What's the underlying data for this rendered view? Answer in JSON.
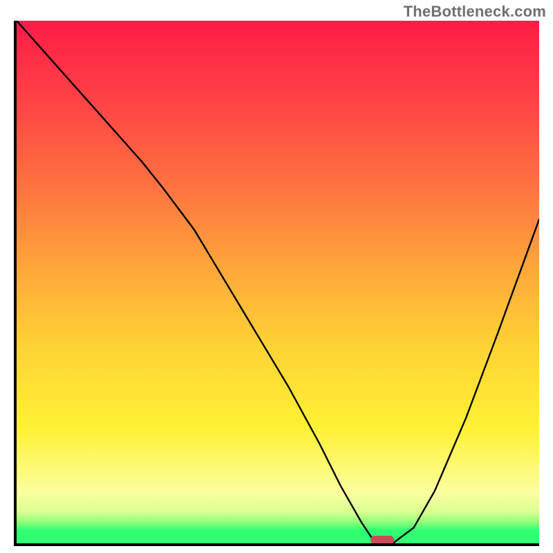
{
  "watermark": "TheBottleneck.com",
  "colors": {
    "gradient_top": "#ff1b47",
    "gradient_mid": "#ffd235",
    "gradient_bottom_band": "#2fff73",
    "curve": "#000000",
    "marker": "#c94d57"
  },
  "chart_data": {
    "type": "line",
    "title": "",
    "xlabel": "",
    "ylabel": "",
    "xlim": [
      0,
      100
    ],
    "ylim": [
      0,
      100
    ],
    "x": [
      0,
      8,
      16,
      24,
      28,
      34,
      40,
      46,
      52,
      58,
      62,
      66,
      68,
      72,
      76,
      80,
      86,
      92,
      100
    ],
    "values": [
      100,
      91,
      82,
      73,
      68,
      60,
      50,
      40,
      30,
      19,
      11,
      4,
      1,
      0,
      3,
      10,
      24,
      40,
      62
    ],
    "marker": {
      "x": 70,
      "y": 0
    },
    "annotations": [
      "TheBottleneck.com"
    ]
  }
}
